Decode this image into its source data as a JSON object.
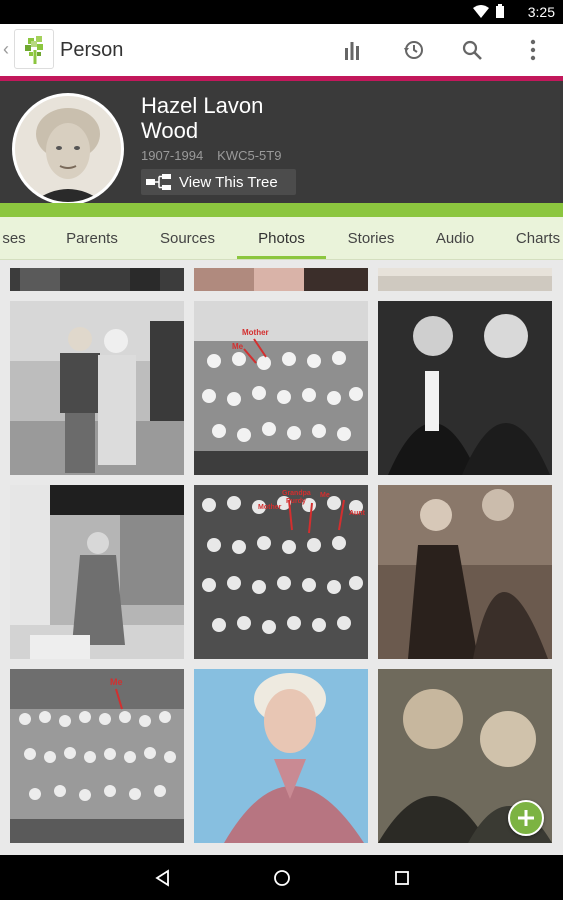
{
  "status_bar": {
    "time": "3:25"
  },
  "app_bar": {
    "title": "Person",
    "actions": [
      "pedigree-icon",
      "history-icon",
      "search-icon",
      "overflow-menu-icon"
    ]
  },
  "person": {
    "name_line1": "Hazel Lavon",
    "name_line2": "Wood",
    "lifespan": "1907-1994",
    "person_id": "KWC5-5T9",
    "view_tree_label": "View This Tree"
  },
  "tabs": {
    "items": [
      "ses",
      "Parents",
      "Sources",
      "Photos",
      "Stories",
      "Audio",
      "Charts"
    ],
    "active": "Photos"
  },
  "photos": {
    "annotations": {
      "group1_mother": "Mother",
      "group1_me": "Me",
      "group2_grandpa": "Grandpa",
      "group2_purdy": "Purdy",
      "group2_mother": "Mother",
      "group2_me": "Me",
      "group2_aunt": "Aunt",
      "class_me": "Me"
    }
  },
  "colors": {
    "accent_pink": "#c2185b",
    "accent_green": "#8cc63f",
    "header_bg": "#3a3a3a",
    "tab_bg": "#eaf3da"
  }
}
